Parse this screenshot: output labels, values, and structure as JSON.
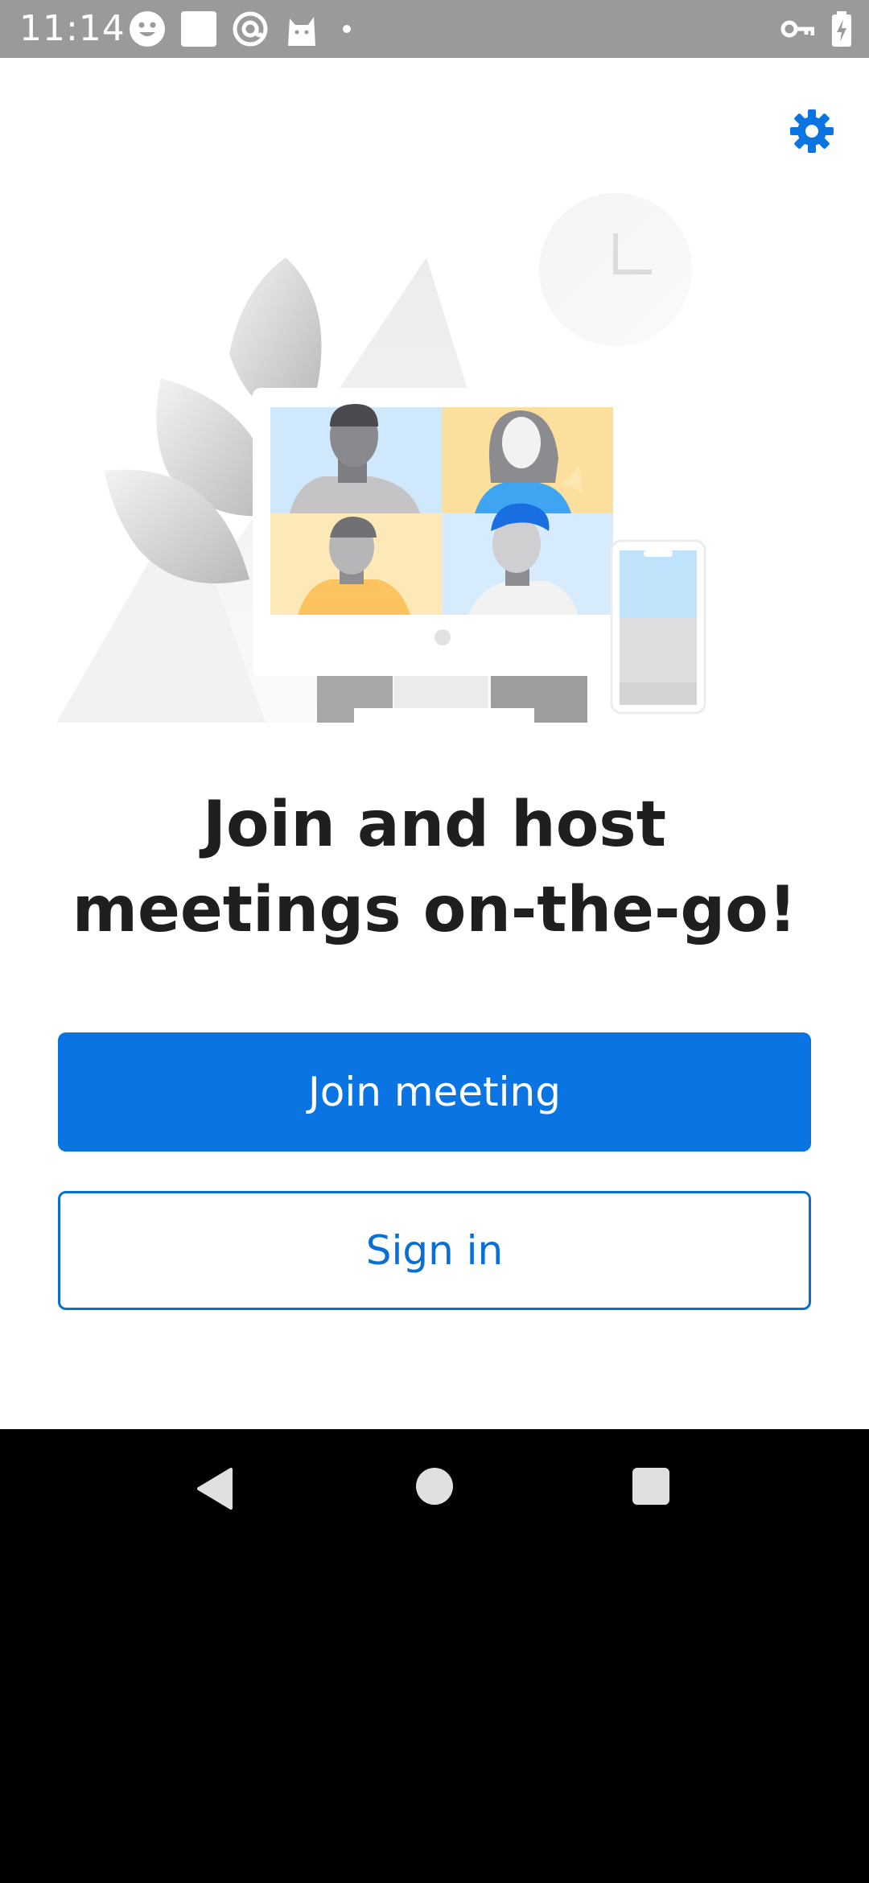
{
  "status_bar": {
    "time": "11:14",
    "left_icons": [
      "smiley-icon",
      "white-square-icon",
      "at-sign-icon",
      "cat-icon",
      "dot-icon"
    ],
    "right_icons": [
      "vpn-key-icon",
      "battery-charging-icon"
    ]
  },
  "header": {
    "settings_icon": "gear-icon",
    "accent_color": "#0a74e3"
  },
  "illustration": {
    "name": "video-meeting-illustration"
  },
  "main": {
    "headline_line1": "Join and host",
    "headline_line2": "meetings on-the-go!",
    "join_label": "Join meeting",
    "signin_label": "Sign in"
  },
  "nav_bar": {
    "icons": [
      "back-icon",
      "home-icon",
      "recents-icon"
    ]
  }
}
